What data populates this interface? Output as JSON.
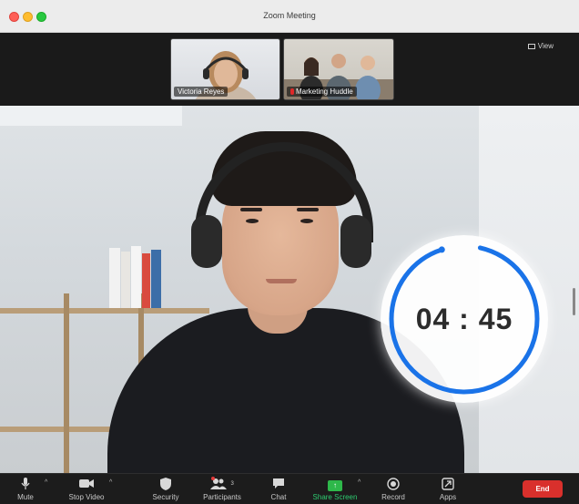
{
  "window": {
    "title": "Zoom Meeting"
  },
  "header": {
    "view_label": "View"
  },
  "thumbnails": [
    {
      "name": "Victoria Reyes",
      "muted": false
    },
    {
      "name": "Marketing Huddle",
      "muted": true
    }
  ],
  "timer": {
    "display": "04 : 45",
    "remaining_fraction": 0.95,
    "ring_color": "#1a73e8"
  },
  "toolbar": {
    "mute": "Mute",
    "stop_video": "Stop Video",
    "security": "Security",
    "participants": "Participants",
    "participants_count": "3",
    "chat": "Chat",
    "share_screen": "Share Screen",
    "record": "Record",
    "apps": "Apps",
    "end": "End"
  },
  "colors": {
    "accent_green": "#2eb84a",
    "end_red": "#d9302c"
  }
}
